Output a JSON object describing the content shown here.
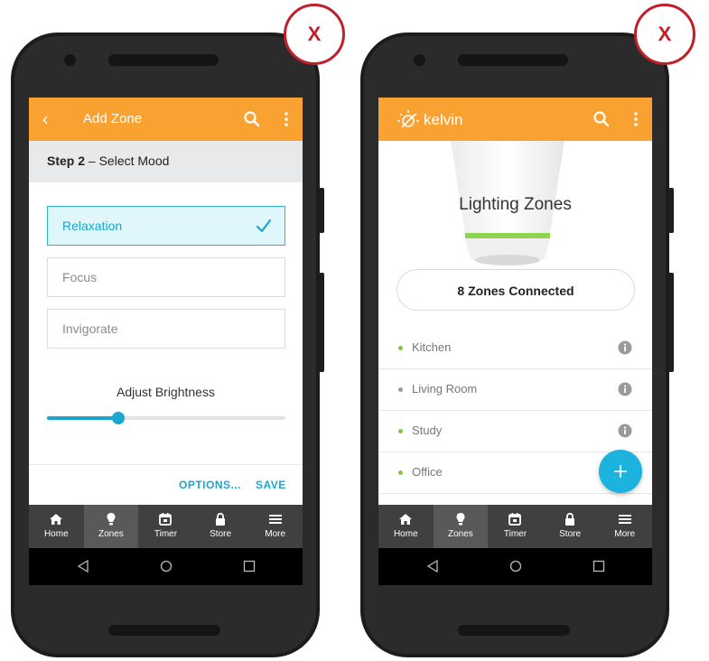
{
  "left_phone": {
    "appbar": {
      "back_icon": "chevron-left-icon",
      "title": "Add Zone",
      "search_icon": "search-icon",
      "menu_icon": "more-vertical-icon"
    },
    "step": {
      "label": "Step 2",
      "text": " – Select Mood"
    },
    "moods": [
      {
        "label": "Relaxation",
        "selected": true
      },
      {
        "label": "Focus",
        "selected": false
      },
      {
        "label": "Invigorate",
        "selected": false
      }
    ],
    "brightness": {
      "label": "Adjust Brightness",
      "value_fraction": 0.3
    },
    "actions": {
      "options": "OPTIONS...",
      "save": "SAVE"
    }
  },
  "right_phone": {
    "appbar": {
      "brand": "kelvin",
      "logo_icon": "sun-logo-icon",
      "search_icon": "search-icon",
      "menu_icon": "more-vertical-icon"
    },
    "title": "Lighting Zones",
    "connected": "8 Zones Connected",
    "zones": [
      {
        "label": "Kitchen",
        "status_color": "#7ac943"
      },
      {
        "label": "Living Room",
        "status_color": "#9a9a9a"
      },
      {
        "label": "Study",
        "status_color": "#7ac943"
      },
      {
        "label": "Office",
        "status_color": "#7ac943"
      }
    ],
    "fab_icon": "plus-icon"
  },
  "nav": [
    {
      "label": "Home",
      "icon": "home-icon"
    },
    {
      "label": "Zones",
      "icon": "bulb-icon"
    },
    {
      "label": "Timer",
      "icon": "calendar-icon"
    },
    {
      "label": "Store",
      "icon": "lock-icon"
    },
    {
      "label": "More",
      "icon": "menu-icon"
    }
  ],
  "active_nav": "Zones",
  "close_label": "X",
  "colors": {
    "accent_orange": "#f9a232",
    "accent_blue": "#1aa6cf",
    "close_red": "#c0202a"
  }
}
